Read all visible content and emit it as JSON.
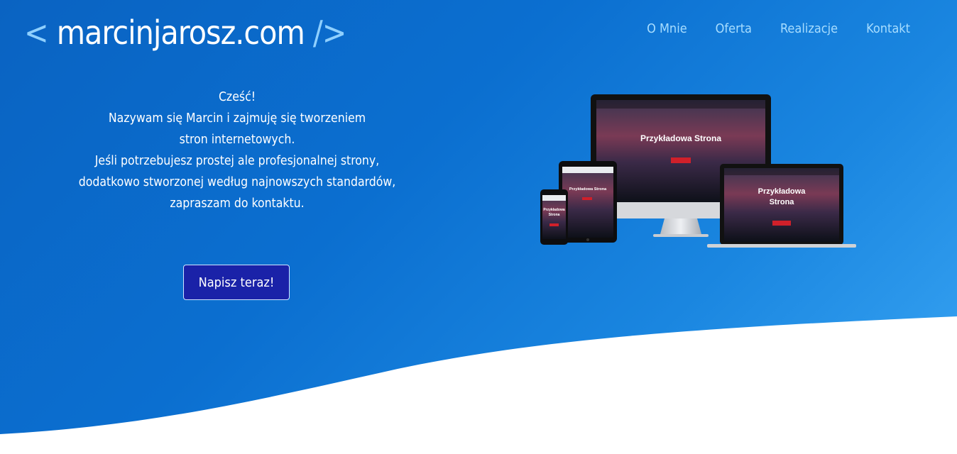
{
  "brand": {
    "open_bracket": "<",
    "name": "marcinjarosz.com",
    "close_bracket": "/>"
  },
  "nav": {
    "items": [
      {
        "label": "O Mnie"
      },
      {
        "label": "Oferta"
      },
      {
        "label": "Realizacje"
      },
      {
        "label": "Kontakt"
      }
    ]
  },
  "intro": {
    "lines": [
      "Cześć!",
      "Nazywam się Marcin i zajmuję się tworzeniem",
      "stron internetowych.",
      "Jeśli potrzebujesz prostej ale profesjonalnej strony,",
      "dodatkowo stworzonej według najnowszych standardów,",
      "zapraszam do kontaktu."
    ]
  },
  "cta": {
    "label": "Napisz teraz!"
  },
  "mockup": {
    "desktop_title": "Przykładowa Strona",
    "laptop_title_line1": "Przykładowa",
    "laptop_title_line2": "Strona",
    "tablet_title": "Przykładowa Strona",
    "phone_title_line1": "Przykładowa",
    "phone_title_line2": "Strona"
  },
  "colors": {
    "hero_start": "#0a63c2",
    "hero_end": "#3aa6f4",
    "cta_bg": "#1a22a8",
    "nav_link": "#a7ddff",
    "bracket": "#8fd0ff",
    "mockup_button": "#d0202a"
  }
}
